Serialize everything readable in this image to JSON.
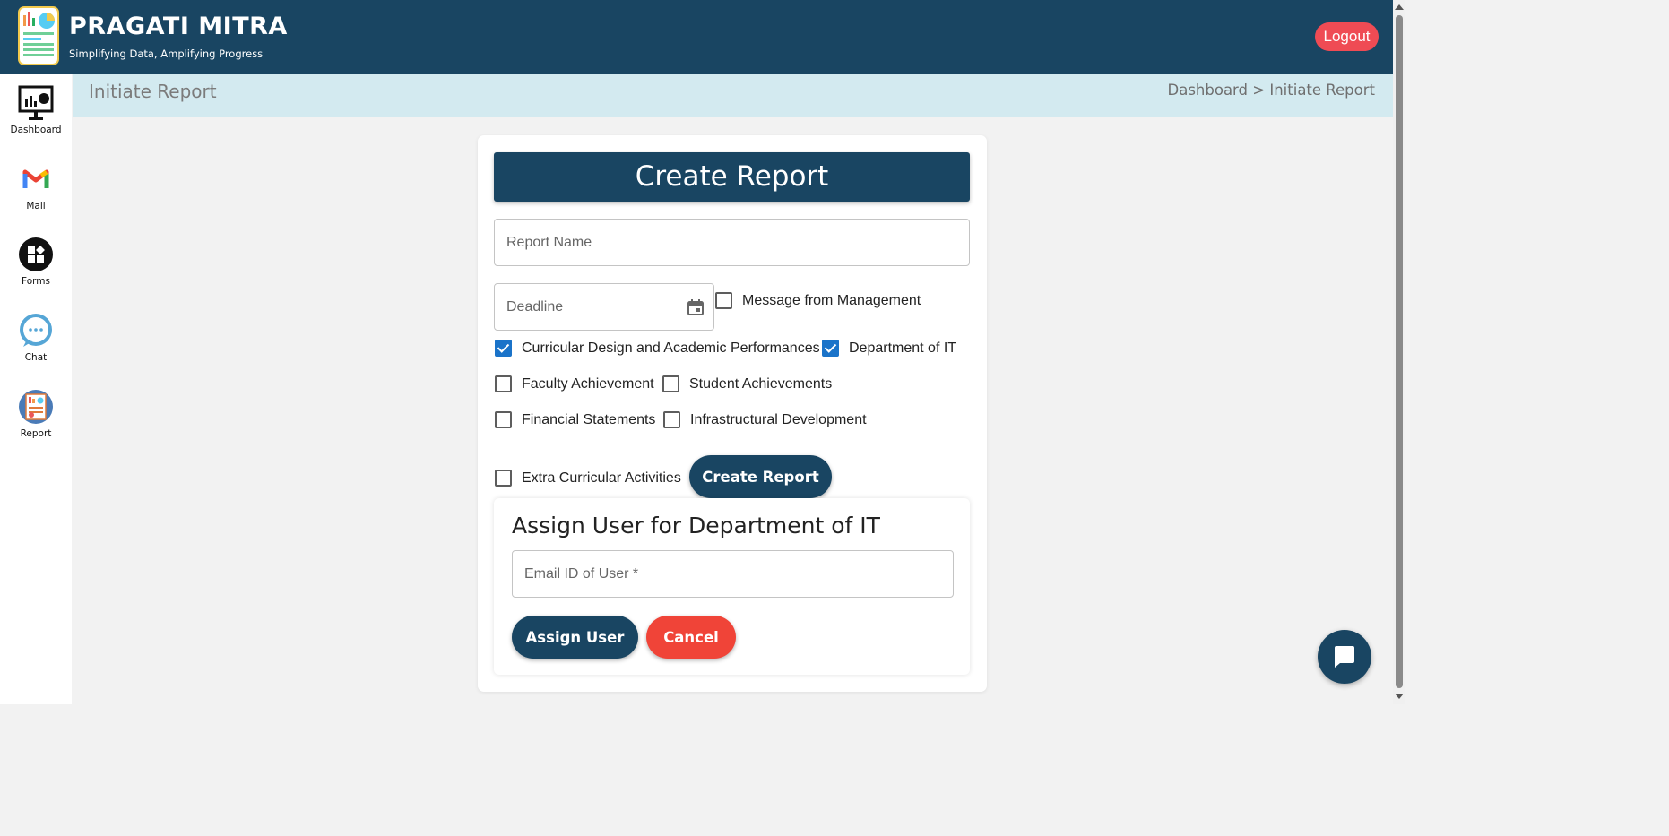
{
  "app": {
    "title": "PRAGATI MITRA",
    "subtitle": "Simplifying Data, Amplifying Progress",
    "logout_label": "Logout"
  },
  "sidebar": {
    "items": [
      {
        "label": "Dashboard",
        "icon": "dashboard-monitor-icon"
      },
      {
        "label": "Mail",
        "icon": "mail-icon"
      },
      {
        "label": "Forms",
        "icon": "forms-icon"
      },
      {
        "label": "Chat",
        "icon": "chat-icon"
      },
      {
        "label": "Report",
        "icon": "report-icon"
      }
    ]
  },
  "page": {
    "title": "Initiate Report",
    "breadcrumb": {
      "home": "Dashboard",
      "separator": " > ",
      "current": "Initiate Report"
    }
  },
  "form": {
    "heading": "Create Report",
    "report_name": {
      "placeholder": "Report Name",
      "value": ""
    },
    "deadline": {
      "placeholder": "Deadline",
      "value": ""
    },
    "checkboxes": [
      {
        "label": "Message from Management",
        "checked": false
      },
      {
        "label": "Curricular Design and Academic Performances",
        "checked": true
      },
      {
        "label": "Department of IT",
        "checked": true
      },
      {
        "label": "Faculty Achievement",
        "checked": false
      },
      {
        "label": "Student Achievements",
        "checked": false
      },
      {
        "label": "Financial Statements",
        "checked": false
      },
      {
        "label": "Infrastructural Development",
        "checked": false
      },
      {
        "label": "Extra Curricular Activities",
        "checked": false
      }
    ],
    "submit_label": "Create Report"
  },
  "assign": {
    "title": "Assign User for Department of IT",
    "email": {
      "placeholder": "Email ID of User *",
      "value": ""
    },
    "assign_label": "Assign User",
    "cancel_label": "Cancel"
  },
  "colors": {
    "primary": "#194562",
    "danger": "#f04438",
    "logout": "#ef4b54",
    "breadcrumb_bg": "#d3eaf0",
    "checkbox_checked": "#1a73c9"
  }
}
